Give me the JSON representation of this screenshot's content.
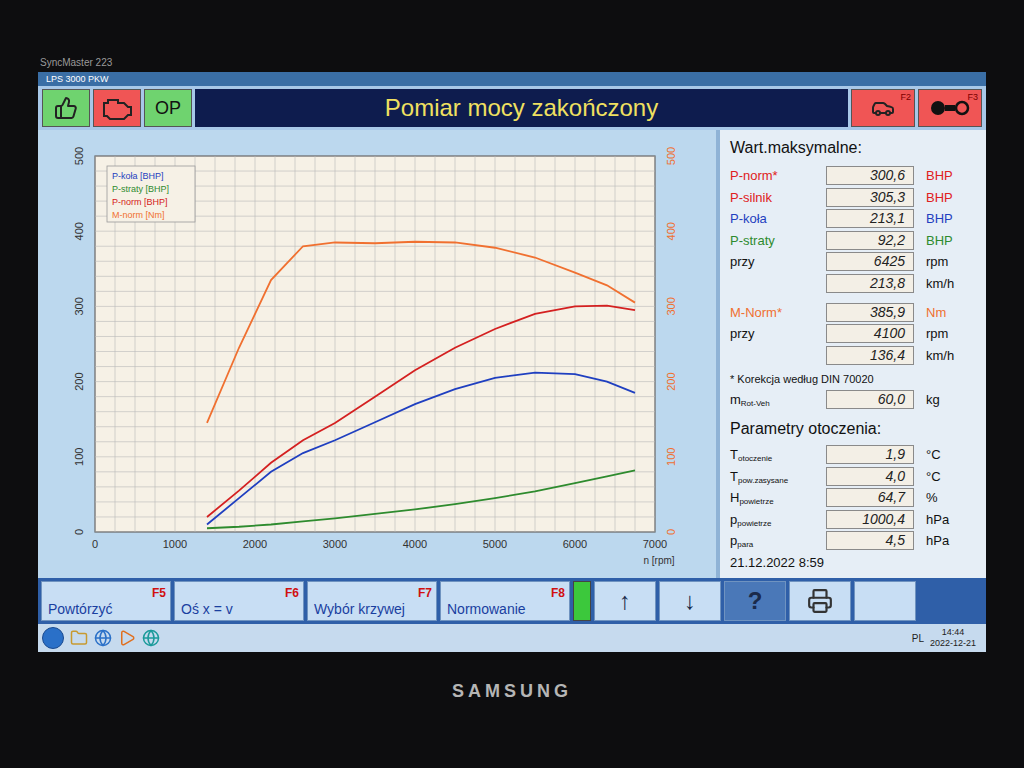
{
  "monitor": {
    "model": "SyncMaster 223",
    "brand": "SAMSUNG"
  },
  "window": {
    "title": "LPS 3000 PKW"
  },
  "toolbar": {
    "left_buttons": [
      {
        "kind": "thumbs",
        "label": "",
        "color": "#6fd36f"
      },
      {
        "kind": "engine",
        "label": "",
        "color": "#f05555"
      },
      {
        "kind": "text",
        "label": "OP",
        "color": "#6fd36f"
      }
    ],
    "banner": "Pomiar mocy zakończony",
    "right_buttons": [
      {
        "kind": "dyno",
        "key": "F2"
      },
      {
        "kind": "wheels",
        "key": "F3"
      }
    ]
  },
  "chart": {
    "legend": [
      {
        "name": "P-koła [BHP]",
        "color": "#1f3fc0"
      },
      {
        "name": "P-straty [BHP]",
        "color": "#2e8b2e"
      },
      {
        "name": "P-norm [BHP]",
        "color": "#d42020"
      },
      {
        "name": "M-norm [Nm]",
        "color": "#f07030"
      }
    ],
    "x_label": "n [rpm]",
    "x_ticks": [
      "0",
      "1000",
      "2000",
      "3000",
      "4000",
      "5000",
      "6000",
      "7000"
    ],
    "y_ticks_left": [
      "0",
      "100",
      "200",
      "300",
      "400",
      "500"
    ],
    "y_ticks_right": [
      "0",
      "100",
      "200",
      "300",
      "400",
      "500"
    ],
    "rpm": [
      1400,
      1800,
      2200,
      2600,
      3000,
      3500,
      4000,
      4500,
      5000,
      5500,
      6000,
      6400,
      6750
    ],
    "series": [
      {
        "name": "P-koła [BHP]",
        "color": "#1f3fc0",
        "values": [
          10,
          45,
          80,
          105,
          122,
          146,
          170,
          190,
          205,
          212,
          210,
          200,
          185
        ]
      },
      {
        "name": "P-straty [BHP]",
        "color": "#2e8b2e",
        "values": [
          5,
          7,
          10,
          14,
          18,
          24,
          30,
          37,
          45,
          54,
          65,
          74,
          82
        ]
      },
      {
        "name": "P-norm [BHP]",
        "color": "#d42020",
        "values": [
          20,
          55,
          92,
          122,
          145,
          180,
          215,
          245,
          270,
          290,
          300,
          301,
          295
        ]
      },
      {
        "name": "M-norm [Nm]",
        "color": "#f07030",
        "values": [
          145,
          245,
          335,
          380,
          385,
          384,
          386,
          385,
          378,
          365,
          345,
          328,
          305
        ]
      }
    ]
  },
  "max_values": {
    "heading": "Wart.maksymalne:",
    "rows": [
      {
        "label": "P-norm*",
        "value": "300,6",
        "unit": "BHP",
        "color": "#e02020"
      },
      {
        "label": "P-silnik",
        "value": "305,3",
        "unit": "BHP",
        "color": "#e02020"
      },
      {
        "label": "P-koła",
        "value": "213,1",
        "unit": "BHP",
        "color": "#1f3fc0"
      },
      {
        "label": "P-straty",
        "value": "92,2",
        "unit": "BHP",
        "color": "#2e8b2e"
      },
      {
        "label": "przy",
        "value": "6425",
        "unit": "rpm",
        "color": "#111111"
      },
      {
        "label": "",
        "value": "213,8",
        "unit": "km/h",
        "color": "#111111"
      }
    ],
    "torque_rows": [
      {
        "label": "M-Norm*",
        "value": "385,9",
        "unit": "Nm",
        "color": "#f07030"
      },
      {
        "label": "przy",
        "value": "4100",
        "unit": "rpm",
        "color": "#111111"
      },
      {
        "label": "",
        "value": "136,4",
        "unit": "km/h",
        "color": "#111111"
      }
    ]
  },
  "note": "* Korekcja według DIN 70020",
  "rot_mass": {
    "label": "m",
    "sub": "Rot-Veh",
    "value": "60,0",
    "unit": "kg"
  },
  "ambient": {
    "heading": "Parametry otoczenia:",
    "rows": [
      {
        "label": "T",
        "sub": "otoczenie",
        "value": "1,9",
        "unit": "°C"
      },
      {
        "label": "T",
        "sub": "pow.zasysane",
        "value": "4,0",
        "unit": "°C"
      },
      {
        "label": "H",
        "sub": "powietrze",
        "value": "64,7",
        "unit": "%"
      },
      {
        "label": "p",
        "sub": "powietrze",
        "value": "1000,4",
        "unit": "hPa"
      },
      {
        "label": "p",
        "sub": "para",
        "value": "4,5",
        "unit": "hPa"
      }
    ]
  },
  "timestamp": "21.12.2022 8:59",
  "function_keys": [
    {
      "label": "Powtórzyć",
      "key": "F5"
    },
    {
      "label": "Oś x = v",
      "key": "F6"
    },
    {
      "label": "Wybór krzywej",
      "key": "F7"
    },
    {
      "label": "Normowanie",
      "key": "F8"
    }
  ],
  "level_meter": {
    "level": 1
  },
  "nav_buttons": [
    {
      "kind": "up",
      "symbol": "↑"
    },
    {
      "kind": "down",
      "symbol": "↓"
    },
    {
      "kind": "help",
      "symbol": "?"
    },
    {
      "kind": "print",
      "symbol": ""
    },
    {
      "kind": "blank",
      "symbol": ""
    }
  ],
  "taskbar": {
    "lang": "PL",
    "time": "14:44",
    "date": "2022-12-21"
  }
}
